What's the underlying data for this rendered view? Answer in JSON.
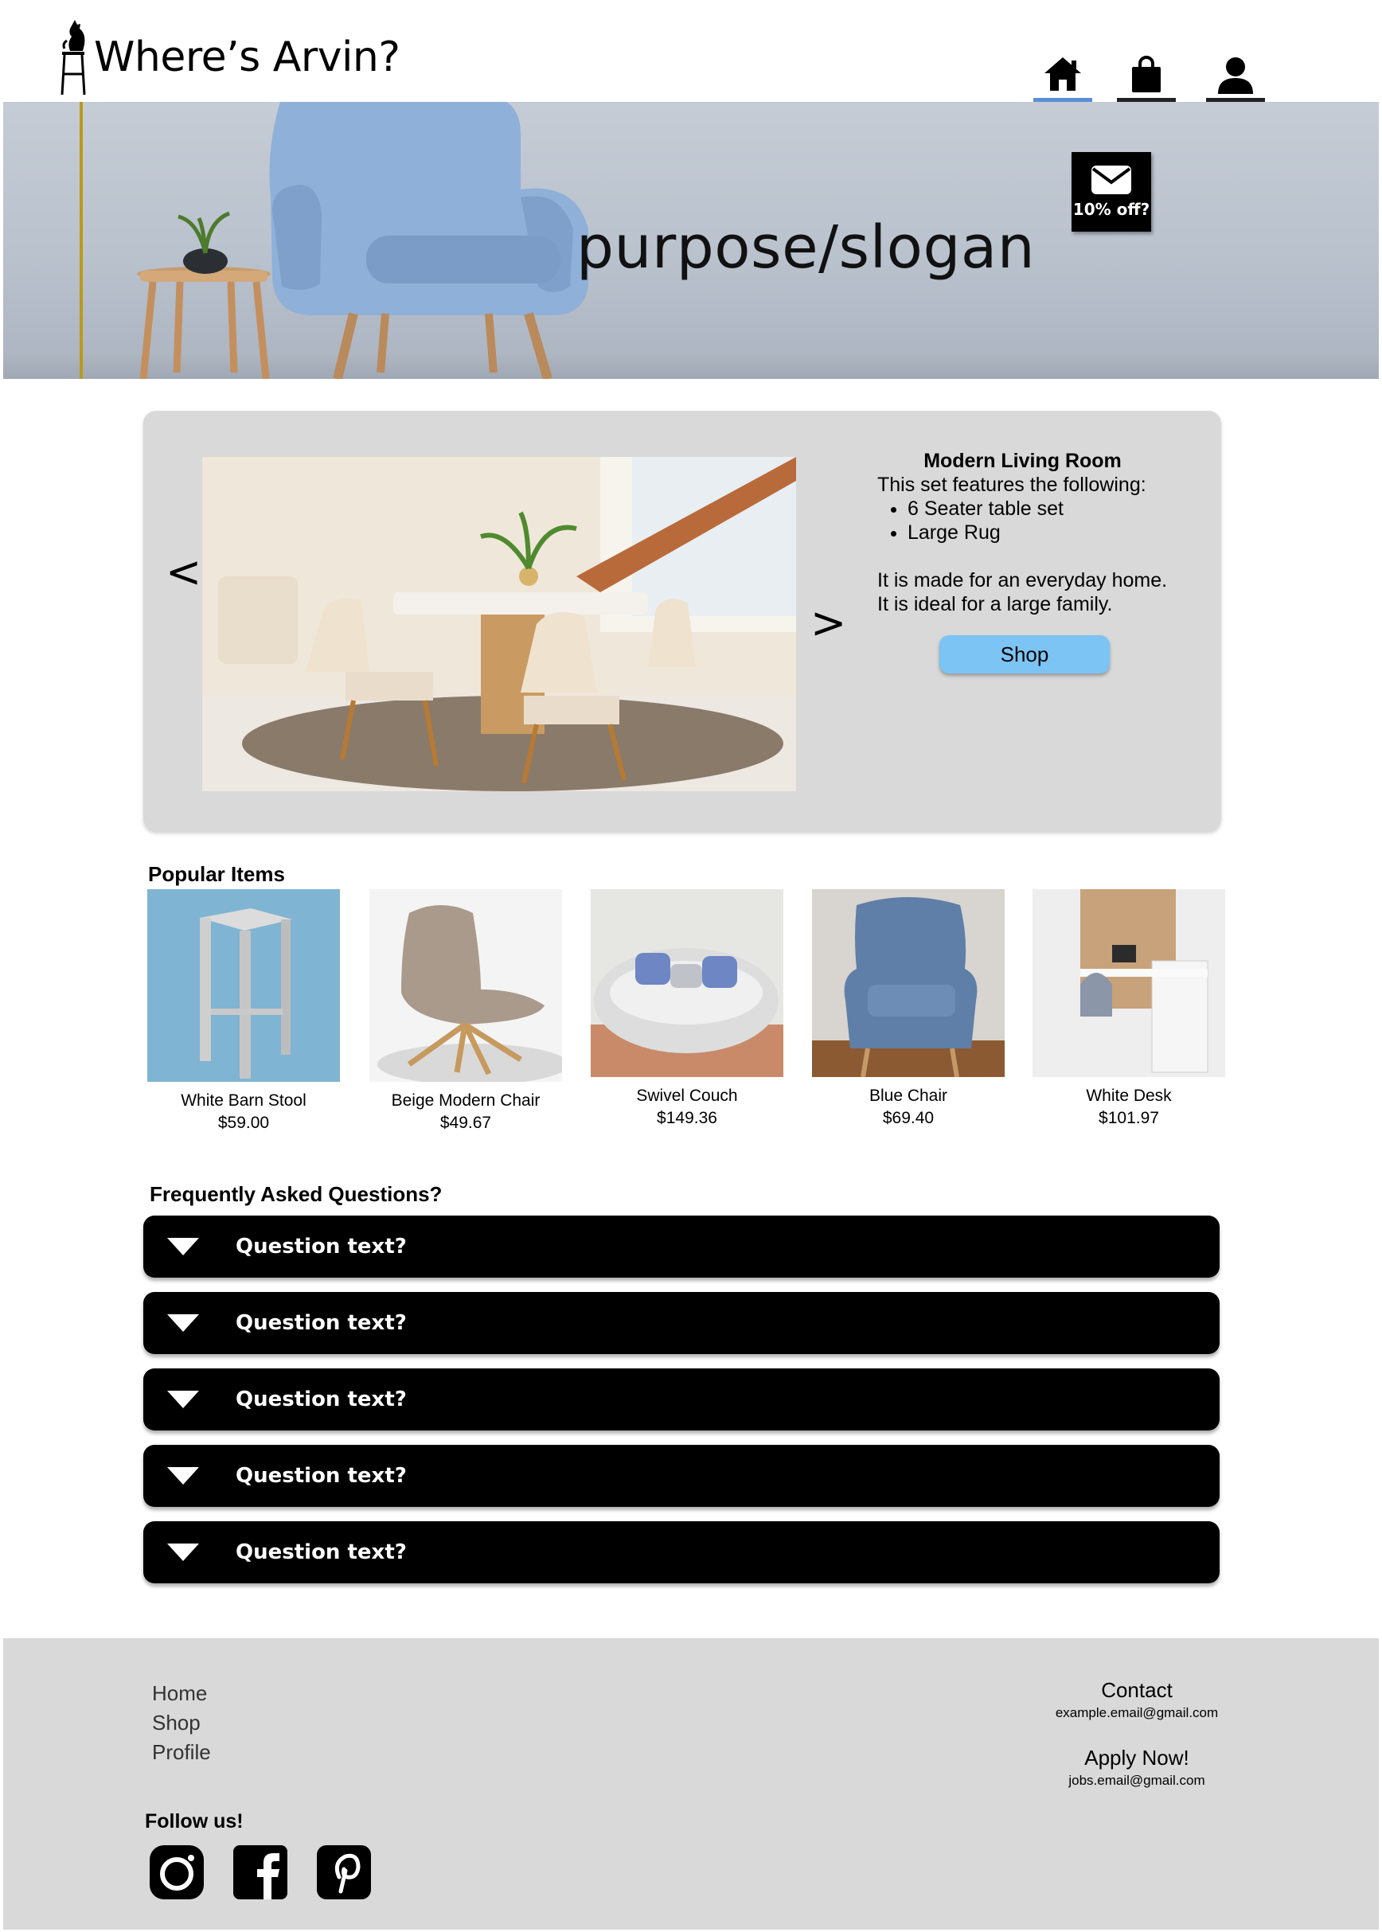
{
  "brand": {
    "name": "Where’s Arvin?"
  },
  "nav": [
    {
      "label": "home",
      "icon": "home-icon",
      "active": true
    },
    {
      "label": "shop",
      "icon": "shopping-bag-icon",
      "active": false
    },
    {
      "label": "profile",
      "icon": "user-icon",
      "active": false
    }
  ],
  "hero": {
    "slogan": "purpose/slogan",
    "promo": {
      "label": "10% off?",
      "icon": "mail-icon"
    }
  },
  "featured": {
    "title": "Modern Living Room",
    "intro": "This set features the following:",
    "items": [
      "6 Seater table set",
      "Large Rug"
    ],
    "line1": "It is made for an everyday home.",
    "line2": "It is ideal for a large family.",
    "button": "Shop",
    "prev": "<",
    "next": ">"
  },
  "popular": {
    "heading": "Popular Items",
    "items": [
      {
        "name": "White Barn Stool",
        "price": "$59.00"
      },
      {
        "name": "Beige Modern Chair",
        "price": "$49.67"
      },
      {
        "name": "Swivel Couch",
        "price": "$149.36"
      },
      {
        "name": "Blue Chair",
        "price": "$69.40"
      },
      {
        "name": "White Desk",
        "price": "$101.97"
      }
    ]
  },
  "faq": {
    "heading": "Frequently Asked Questions?",
    "questions": [
      "Question text?",
      "Question text?",
      "Question text?",
      "Question text?",
      "Question text?"
    ]
  },
  "footer": {
    "links": [
      "Home",
      "Shop",
      "Profile"
    ],
    "contact": {
      "heading": "Contact",
      "email": "example.email@gmail.com"
    },
    "apply": {
      "heading": "Apply Now!",
      "email": "jobs.email@gmail.com"
    },
    "follow": "Follow us!",
    "social": [
      "instagram-icon",
      "facebook-icon",
      "pinterest-icon"
    ]
  },
  "colors": {
    "accent": "#5b8ed6",
    "button": "#7cc4f4",
    "panel": "#d9d9d9"
  }
}
